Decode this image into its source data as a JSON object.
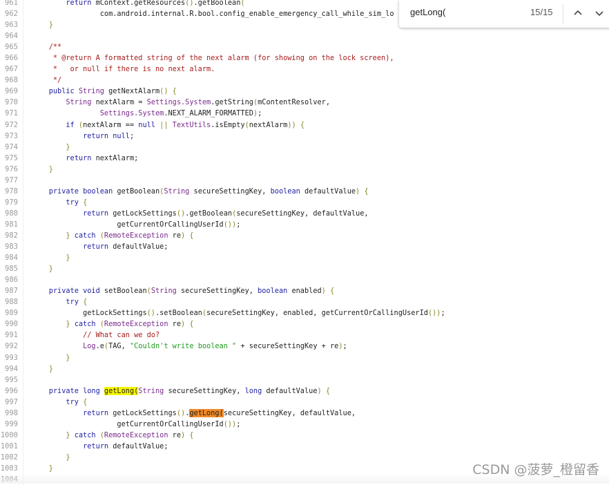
{
  "find_bar": {
    "query": "getLong(",
    "count": "15/15",
    "prev_icon": "chevron-up-icon",
    "next_icon": "chevron-down-icon"
  },
  "watermark": "CSDN @菠萝_橙留香",
  "colors": {
    "keyword": "#1e1ea0",
    "type": "#7a2a8c",
    "punctuation": "#8a8528",
    "comment": "#a81c1c",
    "string": "#1f9a1f",
    "match_highlight": "#f6f600",
    "current_match": "#f08a28"
  },
  "lines": [
    {
      "n": "961",
      "tokens": [
        [
          "",
          "        "
        ],
        [
          "k",
          "return"
        ],
        [
          "",
          " mContext.getResources"
        ],
        [
          "p",
          "()"
        ],
        [
          "",
          ".getBoolean"
        ],
        [
          "p",
          "("
        ]
      ]
    },
    {
      "n": "962",
      "tokens": [
        [
          "",
          "                com.android.internal.R.bool.config_enable_emergency_call_while_sim_lo"
        ]
      ]
    },
    {
      "n": "963",
      "tokens": [
        [
          "",
          "    "
        ],
        [
          "p",
          "}"
        ]
      ]
    },
    {
      "n": "964",
      "tokens": []
    },
    {
      "n": "965",
      "tokens": [
        [
          "",
          "    "
        ],
        [
          "c",
          "/**"
        ]
      ]
    },
    {
      "n": "966",
      "tokens": [
        [
          "",
          "     "
        ],
        [
          "c",
          "* @return A formatted string of the next alarm (for showing on the lock screen),"
        ]
      ]
    },
    {
      "n": "967",
      "tokens": [
        [
          "",
          "     "
        ],
        [
          "c",
          "*   or null if there is no next alarm."
        ]
      ]
    },
    {
      "n": "968",
      "tokens": [
        [
          "",
          "     "
        ],
        [
          "c",
          "*/"
        ]
      ]
    },
    {
      "n": "969",
      "tokens": [
        [
          "",
          "    "
        ],
        [
          "k",
          "public"
        ],
        [
          "",
          " "
        ],
        [
          "t",
          "String"
        ],
        [
          "",
          " getNextAlarm"
        ],
        [
          "p",
          "()"
        ],
        [
          "",
          " "
        ],
        [
          "p",
          "{"
        ]
      ]
    },
    {
      "n": "970",
      "tokens": [
        [
          "",
          "        "
        ],
        [
          "t",
          "String"
        ],
        [
          "",
          " nextAlarm = "
        ],
        [
          "t",
          "Settings.System"
        ],
        [
          "",
          ".getString"
        ],
        [
          "p",
          "("
        ],
        [
          "",
          "mContentResolver,"
        ]
      ]
    },
    {
      "n": "971",
      "tokens": [
        [
          "",
          "                "
        ],
        [
          "t",
          "Settings.System"
        ],
        [
          "",
          ".NEXT_ALARM_FORMATTED"
        ],
        [
          "p",
          ")"
        ],
        [
          "",
          ";"
        ]
      ]
    },
    {
      "n": "972",
      "tokens": [
        [
          "",
          "        "
        ],
        [
          "k",
          "if"
        ],
        [
          "",
          " "
        ],
        [
          "p",
          "("
        ],
        [
          "",
          "nextAlarm == "
        ],
        [
          "k",
          "null"
        ],
        [
          "",
          " "
        ],
        [
          "p",
          "||"
        ],
        [
          "",
          " "
        ],
        [
          "t",
          "TextUtils"
        ],
        [
          "",
          ".isEmpty"
        ],
        [
          "p",
          "("
        ],
        [
          "",
          "nextAlarm"
        ],
        [
          "p",
          "))"
        ],
        [
          "",
          " "
        ],
        [
          "p",
          "{"
        ]
      ]
    },
    {
      "n": "973",
      "tokens": [
        [
          "",
          "            "
        ],
        [
          "k",
          "return"
        ],
        [
          "",
          " "
        ],
        [
          "k",
          "null"
        ],
        [
          "",
          ";"
        ]
      ]
    },
    {
      "n": "974",
      "tokens": [
        [
          "",
          "        "
        ],
        [
          "p",
          "}"
        ]
      ]
    },
    {
      "n": "975",
      "tokens": [
        [
          "",
          "        "
        ],
        [
          "k",
          "return"
        ],
        [
          "",
          " nextAlarm;"
        ]
      ]
    },
    {
      "n": "976",
      "tokens": [
        [
          "",
          "    "
        ],
        [
          "p",
          "}"
        ]
      ]
    },
    {
      "n": "977",
      "tokens": []
    },
    {
      "n": "978",
      "tokens": [
        [
          "",
          "    "
        ],
        [
          "k",
          "private"
        ],
        [
          "",
          " "
        ],
        [
          "k",
          "boolean"
        ],
        [
          "",
          " getBoolean"
        ],
        [
          "p",
          "("
        ],
        [
          "t",
          "String"
        ],
        [
          "",
          " secureSettingKey, "
        ],
        [
          "k",
          "boolean"
        ],
        [
          "",
          " defaultValue"
        ],
        [
          "p",
          ")"
        ],
        [
          "",
          " "
        ],
        [
          "p",
          "{"
        ]
      ]
    },
    {
      "n": "979",
      "tokens": [
        [
          "",
          "        "
        ],
        [
          "k",
          "try"
        ],
        [
          "",
          " "
        ],
        [
          "p",
          "{"
        ]
      ]
    },
    {
      "n": "980",
      "tokens": [
        [
          "",
          "            "
        ],
        [
          "k",
          "return"
        ],
        [
          "",
          " getLockSettings"
        ],
        [
          "p",
          "()"
        ],
        [
          "",
          ".getBoolean"
        ],
        [
          "p",
          "("
        ],
        [
          "",
          "secureSettingKey, defaultValue,"
        ]
      ]
    },
    {
      "n": "981",
      "tokens": [
        [
          "",
          "                    getCurrentOrCallingUserId"
        ],
        [
          "p",
          "())"
        ],
        [
          "",
          ";"
        ]
      ]
    },
    {
      "n": "982",
      "tokens": [
        [
          "",
          "        "
        ],
        [
          "p",
          "}"
        ],
        [
          "",
          " "
        ],
        [
          "k",
          "catch"
        ],
        [
          "",
          " "
        ],
        [
          "p",
          "("
        ],
        [
          "t",
          "RemoteException"
        ],
        [
          "",
          " re"
        ],
        [
          "p",
          ")"
        ],
        [
          "",
          " "
        ],
        [
          "p",
          "{"
        ]
      ]
    },
    {
      "n": "983",
      "tokens": [
        [
          "",
          "            "
        ],
        [
          "k",
          "return"
        ],
        [
          "",
          " defaultValue;"
        ]
      ]
    },
    {
      "n": "984",
      "tokens": [
        [
          "",
          "        "
        ],
        [
          "p",
          "}"
        ]
      ]
    },
    {
      "n": "985",
      "tokens": [
        [
          "",
          "    "
        ],
        [
          "p",
          "}"
        ]
      ]
    },
    {
      "n": "986",
      "tokens": []
    },
    {
      "n": "987",
      "tokens": [
        [
          "",
          "    "
        ],
        [
          "k",
          "private"
        ],
        [
          "",
          " "
        ],
        [
          "k",
          "void"
        ],
        [
          "",
          " setBoolean"
        ],
        [
          "p",
          "("
        ],
        [
          "t",
          "String"
        ],
        [
          "",
          " secureSettingKey, "
        ],
        [
          "k",
          "boolean"
        ],
        [
          "",
          " enabled"
        ],
        [
          "p",
          ")"
        ],
        [
          "",
          " "
        ],
        [
          "p",
          "{"
        ]
      ]
    },
    {
      "n": "988",
      "tokens": [
        [
          "",
          "        "
        ],
        [
          "k",
          "try"
        ],
        [
          "",
          " "
        ],
        [
          "p",
          "{"
        ]
      ]
    },
    {
      "n": "989",
      "tokens": [
        [
          "",
          "            getLockSettings"
        ],
        [
          "p",
          "()"
        ],
        [
          "",
          ".setBoolean"
        ],
        [
          "p",
          "("
        ],
        [
          "",
          "secureSettingKey, enabled, getCurrentOrCallingUserId"
        ],
        [
          "p",
          "())"
        ],
        [
          "",
          ";"
        ]
      ]
    },
    {
      "n": "990",
      "tokens": [
        [
          "",
          "        "
        ],
        [
          "p",
          "}"
        ],
        [
          "",
          " "
        ],
        [
          "k",
          "catch"
        ],
        [
          "",
          " "
        ],
        [
          "p",
          "("
        ],
        [
          "t",
          "RemoteException"
        ],
        [
          "",
          " re"
        ],
        [
          "p",
          ")"
        ],
        [
          "",
          " "
        ],
        [
          "p",
          "{"
        ]
      ]
    },
    {
      "n": "991",
      "tokens": [
        [
          "",
          "            "
        ],
        [
          "c",
          "// What can we do?"
        ]
      ]
    },
    {
      "n": "992",
      "tokens": [
        [
          "",
          "            "
        ],
        [
          "t",
          "Log"
        ],
        [
          "",
          ".e"
        ],
        [
          "p",
          "("
        ],
        [
          "",
          "TAG, "
        ],
        [
          "s",
          "\"Couldn't write boolean \""
        ],
        [
          "",
          " + secureSettingKey + re"
        ],
        [
          "p",
          ")"
        ],
        [
          "",
          ";"
        ]
      ]
    },
    {
      "n": "993",
      "tokens": [
        [
          "",
          "        "
        ],
        [
          "p",
          "}"
        ]
      ]
    },
    {
      "n": "994",
      "tokens": [
        [
          "",
          "    "
        ],
        [
          "p",
          "}"
        ]
      ]
    },
    {
      "n": "995",
      "tokens": []
    },
    {
      "n": "996",
      "tokens": [
        [
          "",
          "    "
        ],
        [
          "k",
          "private"
        ],
        [
          "",
          " "
        ],
        [
          "k",
          "long"
        ],
        [
          "",
          " "
        ],
        [
          "hl",
          "getLong("
        ],
        [
          "t",
          "String"
        ],
        [
          "",
          " secureSettingKey, "
        ],
        [
          "k",
          "long"
        ],
        [
          "",
          " defaultValue"
        ],
        [
          "p",
          ")"
        ],
        [
          "",
          " "
        ],
        [
          "p",
          "{"
        ]
      ]
    },
    {
      "n": "997",
      "tokens": [
        [
          "",
          "        "
        ],
        [
          "k",
          "try"
        ],
        [
          "",
          " "
        ],
        [
          "p",
          "{"
        ]
      ]
    },
    {
      "n": "998",
      "tokens": [
        [
          "",
          "            "
        ],
        [
          "k",
          "return"
        ],
        [
          "",
          " getLockSettings"
        ],
        [
          "p",
          "()"
        ],
        [
          "",
          "."
        ],
        [
          "hc",
          "getLong("
        ],
        [
          "",
          "secureSettingKey, defaultValue,"
        ]
      ]
    },
    {
      "n": "999",
      "tokens": [
        [
          "",
          "                    getCurrentOrCallingUserId"
        ],
        [
          "p",
          "())"
        ],
        [
          "",
          ";"
        ]
      ]
    },
    {
      "n": "1000",
      "tokens": [
        [
          "",
          "        "
        ],
        [
          "p",
          "}"
        ],
        [
          "",
          " "
        ],
        [
          "k",
          "catch"
        ],
        [
          "",
          " "
        ],
        [
          "p",
          "("
        ],
        [
          "t",
          "RemoteException"
        ],
        [
          "",
          " re"
        ],
        [
          "p",
          ")"
        ],
        [
          "",
          " "
        ],
        [
          "p",
          "{"
        ]
      ]
    },
    {
      "n": "1001",
      "tokens": [
        [
          "",
          "            "
        ],
        [
          "k",
          "return"
        ],
        [
          "",
          " defaultValue;"
        ]
      ]
    },
    {
      "n": "1002",
      "tokens": [
        [
          "",
          "        "
        ],
        [
          "p",
          "}"
        ]
      ]
    },
    {
      "n": "1003",
      "tokens": [
        [
          "",
          "    "
        ],
        [
          "p",
          "}"
        ]
      ]
    },
    {
      "n": "1004",
      "tokens": []
    }
  ]
}
